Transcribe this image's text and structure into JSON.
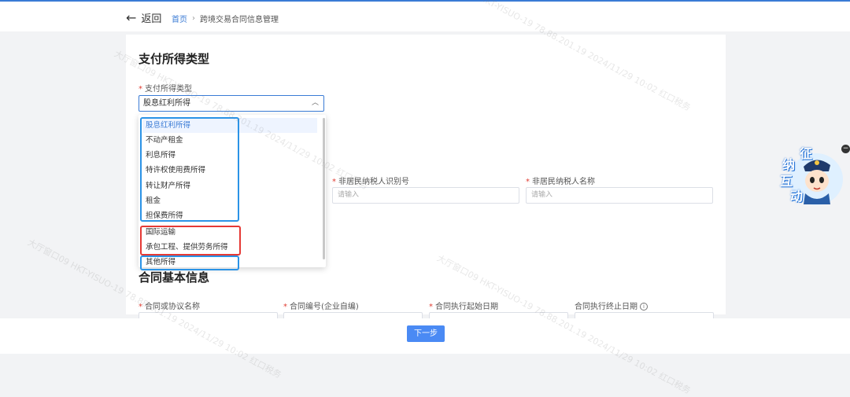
{
  "header": {
    "back_label": "返回",
    "breadcrumb_home": "首页",
    "breadcrumb_current": "跨境交易合同信息管理"
  },
  "section_payment": {
    "title": "支付所得类型",
    "field_label": "支付所得类型",
    "selected_value": "股息红利所得",
    "options": [
      "股息红利所得",
      "不动产租金",
      "利息所得",
      "特许权使用费所得",
      "转让财产所得",
      "租金",
      "担保费所得",
      "国际运输",
      "承包工程、提供劳务所得",
      "其他所得"
    ]
  },
  "taxpayer": {
    "id_label": "非居民纳税人识别号",
    "id_placeholder": "请输入",
    "name_label": "非居民纳税人名称",
    "name_placeholder": "请输入"
  },
  "contract": {
    "title": "合同基本信息",
    "fields": [
      "合同或协议名称",
      "合同编号(企业自编)",
      "合同执行起始日期",
      "合同执行终止日期"
    ]
  },
  "footer": {
    "next_label": "下一步"
  },
  "mascot": {
    "chars": [
      "征",
      "纳",
      "互",
      "动"
    ],
    "collapse": "−"
  },
  "watermark": {
    "text": "大厅窗口09 HKT-YISUO-19 78.88.201.19 2024/11/29 10:02 红口税务"
  },
  "colors": {
    "accent": "#3a7bd5",
    "required": "#e03c31",
    "highlight_blue": "#2b93e6",
    "highlight_red": "#e53935",
    "button": "#4a8af4"
  }
}
